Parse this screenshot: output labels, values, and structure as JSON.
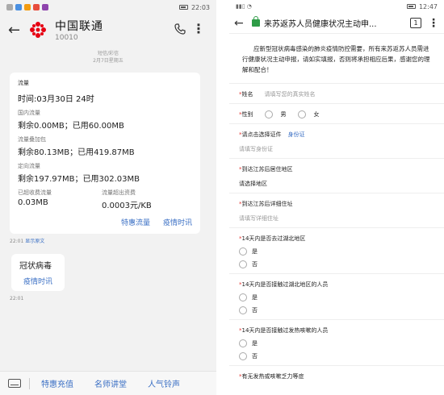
{
  "left": {
    "status_time": "22:03",
    "header": {
      "name": "中国联通",
      "number": "10010"
    },
    "meta": {
      "line1": "短信/彩信",
      "line2": "2月7日星期五"
    },
    "message": {
      "label": "流量",
      "time_line": "时间:03月30日 24时",
      "domestic_label": "国内流量",
      "domestic_value": "剩余0.00MB；已用60.00MB",
      "addon_label": "流量叠加包",
      "addon_value": "剩余80.13MB；已用419.87MB",
      "directed_label": "定向流量",
      "directed_value": "剩余197.97MB；已用302.03MB",
      "fee_label": "已超收费流量",
      "fee_value": "0.03MB",
      "overflow_label": "流量超出资费",
      "overflow_value": "0.0003元/KB",
      "link1": "特惠流量",
      "link2": "疫情时讯"
    },
    "time1": "22:01",
    "show_original": "显示原文",
    "bubble2": {
      "title": "冠状病毒",
      "link": "疫情时讯"
    },
    "time2": "22:01",
    "bottom_menu": [
      "特惠充值",
      "名师讲堂",
      "人气铃声"
    ]
  },
  "right": {
    "status_time": "12:47",
    "url_title": "来苏返苏人员健康状况主动申...",
    "tab_count": "1",
    "intro": "应新型冠状病毒感染的肺炎疫情防控需要，所有来苏返苏人员需进行健康状况主动申报，请如实填报，否则将承担相应后果，感谢您的理解和配合！",
    "name_label": "姓名",
    "name_placeholder": "请填写您的真实姓名",
    "gender_label": "性别",
    "gender_male": "男",
    "gender_female": "女",
    "id_label": "请点击选择证件",
    "id_value": "身份证",
    "id_placeholder": "请填写身份证",
    "arrive_label": "到达江苏后居住地区",
    "arrive_value": "请选择地区",
    "address_label": "到达江苏后详细住址",
    "address_placeholder": "请填写详细住址",
    "q1": "14天内是否去过湖北地区",
    "q2": "14天内是否接触过湖北地区的人员",
    "q3": "14天内是否接触过发热咳嗽的人员",
    "q4": "有无发热或咳嗽乏力等症",
    "yes": "是",
    "no": "否"
  },
  "colors": {
    "link_blue": "#3a6fc4",
    "required_red": "#e53935",
    "lock_green": "#2e9c47",
    "unicom_red": "#e60012"
  }
}
